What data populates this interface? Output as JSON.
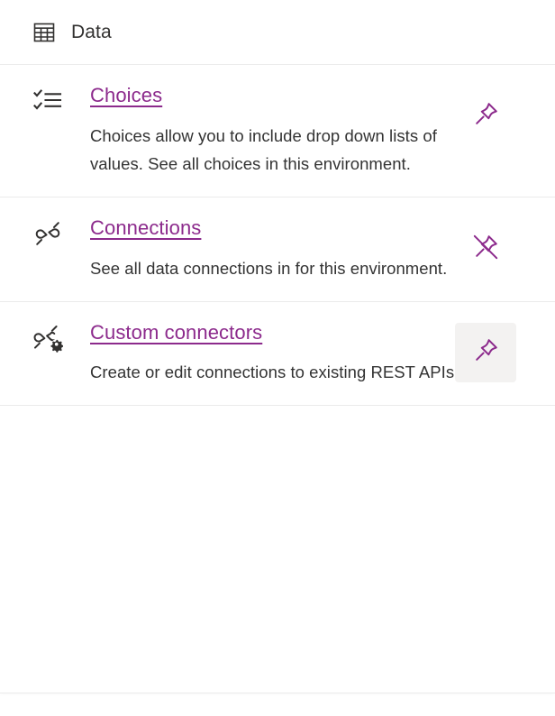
{
  "header": {
    "title": "Data",
    "icon": "table-grid-icon"
  },
  "colors": {
    "link": "#8c2a8c",
    "text": "#333333",
    "divider": "#ebebeb",
    "pin_active_background": "#f3f2f1"
  },
  "cards": [
    {
      "id": "choices",
      "icon": "checklist-icon",
      "link_label": "Choices",
      "description": "Choices allow you to include drop down lists of values. See all choices in this environment.",
      "pin": {
        "icon": "pin-icon",
        "state": "unpinned",
        "highlighted": false
      }
    },
    {
      "id": "connections",
      "icon": "plug-connection-icon",
      "link_label": "Connections",
      "description": "See all data connections in for this environment.",
      "pin": {
        "icon": "pin-off-icon",
        "state": "pinned",
        "highlighted": false
      }
    },
    {
      "id": "custom-connectors",
      "icon": "plug-gear-icon",
      "link_label": "Custom connectors",
      "description": "Create or edit connections to existing REST APIs.",
      "pin": {
        "icon": "pin-icon",
        "state": "unpinned",
        "highlighted": true
      }
    }
  ]
}
